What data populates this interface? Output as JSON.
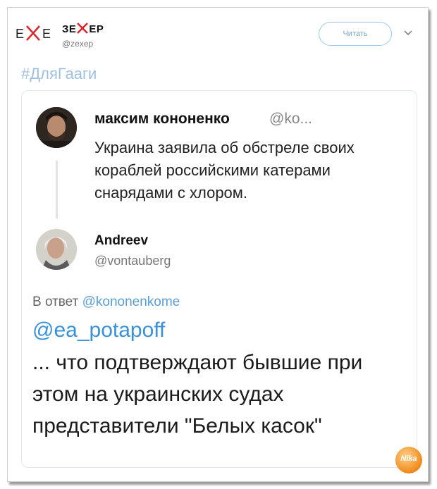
{
  "header": {
    "logo_left": "Е",
    "logo_right": "Е",
    "account_name_pre": "ЗЕ",
    "account_name_post": "ЕР",
    "account_handle": "@zexep",
    "follow_label": "Читать"
  },
  "hashtag": "#ДляГааги",
  "quoted": {
    "name": "максим кононенко",
    "handle": "@ko...",
    "text": "Украина заявила об обстреле своих кораблей российскими катерами снарядами с хлором."
  },
  "reply": {
    "name": "Andreev",
    "handle": "@vontauberg",
    "reply_prefix": "В ответ",
    "reply_to": "@kononenkome",
    "mention": "@ea_potapoff",
    "text": "... что подтверждают бывшие при этом на украинских судах представители \"Белых касок\""
  },
  "watermark": "Nika",
  "colors": {
    "link": "#3a91d8",
    "accent_x": "#d9262b"
  }
}
